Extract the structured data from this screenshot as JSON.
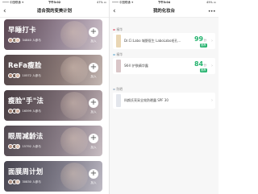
{
  "left": {
    "status": {
      "carrier": "•••• 中国联通 ✦",
      "time": "下午3:02",
      "battery": "47% ▭"
    },
    "nav": {
      "title": "适合我的变美计划",
      "back_icon": "chevron-left"
    },
    "plans": [
      {
        "name": "早睡打卡",
        "count": "34840 人参与",
        "join": "加入"
      },
      {
        "name": "ReFa瘦脸",
        "count": "10572 人参与",
        "join": "加入"
      },
      {
        "name": "瘦脸\"手\"法",
        "count": "16599 人参与",
        "join": "加入"
      },
      {
        "name": "眼周减龄法",
        "count": "15792 人参与",
        "join": "加入"
      },
      {
        "name": "面膜周计划",
        "count": "30830 人参与",
        "join": "加入"
      }
    ]
  },
  "right": {
    "status": {
      "carrier": "•••• 中国联通 ✦",
      "time": "下午3:04",
      "battery": "45% ▭"
    },
    "nav": {
      "title": "我的化妆台",
      "back_icon": "chevron-left",
      "more_icon": "more-dots"
    },
    "sections": [
      {
        "label": "精华",
        "dot_color": "#e88a9a",
        "product": {
          "name": "Dr.Ci:Labo 城野医生 LaboLabo毛孔...",
          "score": "99",
          "unit": "分",
          "tag": "推荐",
          "score_color": "#25b36e",
          "thumb_color": "#e9d6b4"
        }
      },
      {
        "label": "精华",
        "dot_color": "#9cc8e0",
        "product": {
          "name": "SK-II 护肤精华露",
          "score": "84",
          "unit": "分",
          "tag": "推荐",
          "score_color": "#25b36e",
          "thumb_color": "#d9c6c8"
        }
      },
      {
        "label": "防晒",
        "dot_color": "#b9c6d4",
        "product": {
          "name": "科颜氏亮采全效防晒露 SPF 30",
          "score": "",
          "unit": "",
          "tag": "",
          "score_color": "#888888",
          "thumb_color": "#e3e6ec"
        }
      }
    ]
  }
}
